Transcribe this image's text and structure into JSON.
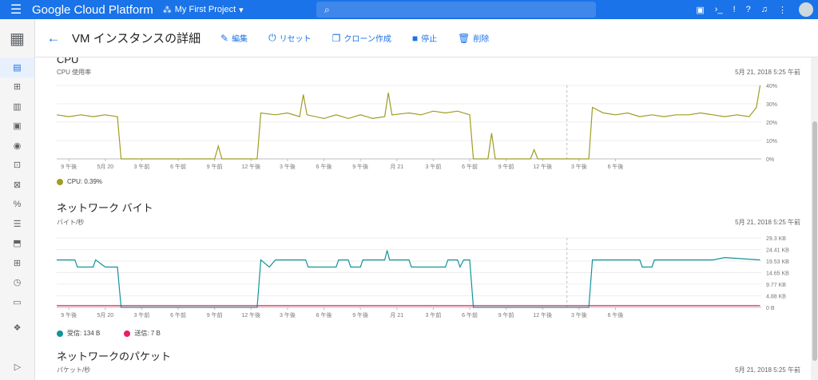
{
  "topbar": {
    "brand": "Google Cloud Platform",
    "project": "My First Project",
    "icons": [
      "menu-icon",
      "project-picker-icon",
      "search-icon",
      "gift-icon",
      "cloud-shell-icon",
      "support-icon",
      "help-icon",
      "notifications-icon",
      "more-vert-icon",
      "account-icon"
    ]
  },
  "rail": {
    "logo": "compute-engine-icon",
    "items": [
      "vm-instances-icon",
      "instance-groups-icon",
      "instance-templates-icon",
      "sole-tenant-icon",
      "disks-icon",
      "snapshots-icon",
      "images-icon",
      "tpus-icon",
      "commitments-icon",
      "metadata-icon",
      "health-checks-icon",
      "zones-icon",
      "settings-icon"
    ],
    "bottom": "collapse-icon",
    "active_index": 0
  },
  "toolbar": {
    "title": "VM インスタンスの詳細",
    "actions": [
      {
        "label": "編集",
        "icon": "edit-icon"
      },
      {
        "label": "リセット",
        "icon": "power-icon"
      },
      {
        "label": "クローン作成",
        "icon": "copy-icon"
      },
      {
        "label": "停止",
        "icon": "stop-icon"
      },
      {
        "label": "削除",
        "icon": "delete-icon"
      }
    ]
  },
  "sections": {
    "cpu": {
      "title": "CPU",
      "subtitle": "CPU 使用率",
      "timestamp": "5月 21, 2018 5:25 午前",
      "legend": "CPU: 0.39%"
    },
    "net_bytes": {
      "title": "ネットワーク バイト",
      "subtitle": "バイト/秒",
      "timestamp": "5月 21, 2018 5:25 午前",
      "legend_in": "受信: 134 B",
      "legend_out": "送信: 7 B"
    },
    "net_packets": {
      "title": "ネットワークのパケット",
      "subtitle": "パケット/秒",
      "timestamp": "5月 21, 2018 5:25 午前"
    }
  },
  "chart_data": [
    {
      "type": "line",
      "title": "CPU",
      "ylabel": "CPU 使用率",
      "x_tick_labels": [
        "9 午後",
        "5月 20",
        "3 午前",
        "6 午前",
        "9 午前",
        "12 午後",
        "3 午後",
        "6 午後",
        "9 午後",
        "月 21",
        "3 午前",
        "6 午前",
        "9 午前",
        "12 午後",
        "3 午後",
        "6 午後"
      ],
      "y_tick_labels": [
        "40%",
        "30%",
        "20%",
        "10%",
        "0%"
      ],
      "ylim": [
        0,
        40
      ],
      "x_range_hours": [
        -1,
        57
      ],
      "series": [
        {
          "name": "CPU",
          "color": "#9e9d24",
          "points": [
            [
              -1,
              24
            ],
            [
              0,
              23
            ],
            [
              1,
              24
            ],
            [
              2,
              23
            ],
            [
              3,
              24
            ],
            [
              4,
              23
            ],
            [
              4.3,
              0
            ],
            [
              12,
              0
            ],
            [
              12.3,
              7
            ],
            [
              12.6,
              0
            ],
            [
              15.5,
              0
            ],
            [
              15.8,
              25
            ],
            [
              17,
              24
            ],
            [
              18,
              25
            ],
            [
              19,
              23
            ],
            [
              19.3,
              35
            ],
            [
              19.6,
              24
            ],
            [
              21,
              22
            ],
            [
              22,
              24
            ],
            [
              23,
              22
            ],
            [
              24,
              24
            ],
            [
              25,
              22
            ],
            [
              26,
              23
            ],
            [
              26.3,
              36
            ],
            [
              26.6,
              24
            ],
            [
              28,
              25
            ],
            [
              29,
              24
            ],
            [
              30,
              26
            ],
            [
              31,
              25
            ],
            [
              32,
              26
            ],
            [
              33,
              24
            ],
            [
              33.3,
              0
            ],
            [
              34.5,
              0
            ],
            [
              34.8,
              14
            ],
            [
              35.1,
              0
            ],
            [
              38,
              0
            ],
            [
              38.3,
              5
            ],
            [
              38.6,
              0
            ],
            [
              42.8,
              0
            ],
            [
              43.1,
              28
            ],
            [
              44,
              25
            ],
            [
              45,
              24
            ],
            [
              46,
              25
            ],
            [
              47,
              23
            ],
            [
              48,
              24
            ],
            [
              49,
              23
            ],
            [
              50,
              24
            ],
            [
              51,
              24
            ],
            [
              52,
              25
            ],
            [
              53,
              24
            ],
            [
              54,
              23
            ],
            [
              55,
              24
            ],
            [
              56,
              23
            ],
            [
              56.6,
              28
            ],
            [
              56.9,
              40
            ]
          ]
        }
      ],
      "marker_hour": 41
    },
    {
      "type": "line",
      "title": "ネットワーク バイト",
      "ylabel": "バイト/秒",
      "x_tick_labels": [
        "9 午後",
        "5月 20",
        "3 午前",
        "6 午前",
        "9 午前",
        "12 午後",
        "3 午後",
        "6 午後",
        "9 午後",
        "月 21",
        "3 午前",
        "6 午前",
        "9 午前",
        "12 午後",
        "3 午後",
        "6 午後"
      ],
      "y_tick_labels": [
        "29.3 KB",
        "24.41 KB",
        "19.53 KB",
        "14.65 KB",
        "9.77 KB",
        "4.88 KB",
        "0 B"
      ],
      "ylim": [
        0,
        29.3
      ],
      "x_range_hours": [
        -1,
        57
      ],
      "series": [
        {
          "name": "受信",
          "color": "#12939a",
          "points": [
            [
              -1,
              20
            ],
            [
              0.5,
              20
            ],
            [
              0.7,
              17
            ],
            [
              2,
              17
            ],
            [
              2.2,
              20
            ],
            [
              3,
              17
            ],
            [
              4,
              17
            ],
            [
              4.3,
              0
            ],
            [
              15.5,
              0
            ],
            [
              15.8,
              20
            ],
            [
              16.5,
              17
            ],
            [
              17,
              20
            ],
            [
              19.5,
              20
            ],
            [
              19.7,
              17
            ],
            [
              22,
              17
            ],
            [
              22.2,
              20
            ],
            [
              23,
              20
            ],
            [
              23.2,
              17
            ],
            [
              24,
              17
            ],
            [
              24.2,
              20
            ],
            [
              26,
              20
            ],
            [
              26.2,
              24
            ],
            [
              26.4,
              20
            ],
            [
              28,
              20
            ],
            [
              28.2,
              17
            ],
            [
              31,
              17
            ],
            [
              31.2,
              20
            ],
            [
              32,
              20
            ],
            [
              32.2,
              17
            ],
            [
              32.5,
              20
            ],
            [
              33,
              20
            ],
            [
              33.3,
              0
            ],
            [
              42.8,
              0
            ],
            [
              43.1,
              20
            ],
            [
              47,
              20
            ],
            [
              47.2,
              17
            ],
            [
              48,
              17
            ],
            [
              48.2,
              20
            ],
            [
              53,
              20
            ],
            [
              54,
              21
            ],
            [
              56.9,
              20
            ]
          ]
        },
        {
          "name": "送信",
          "color": "#e91e63",
          "points": [
            [
              -1,
              0.7
            ],
            [
              56.9,
              0.7
            ]
          ]
        }
      ],
      "marker_hour": 41
    }
  ]
}
